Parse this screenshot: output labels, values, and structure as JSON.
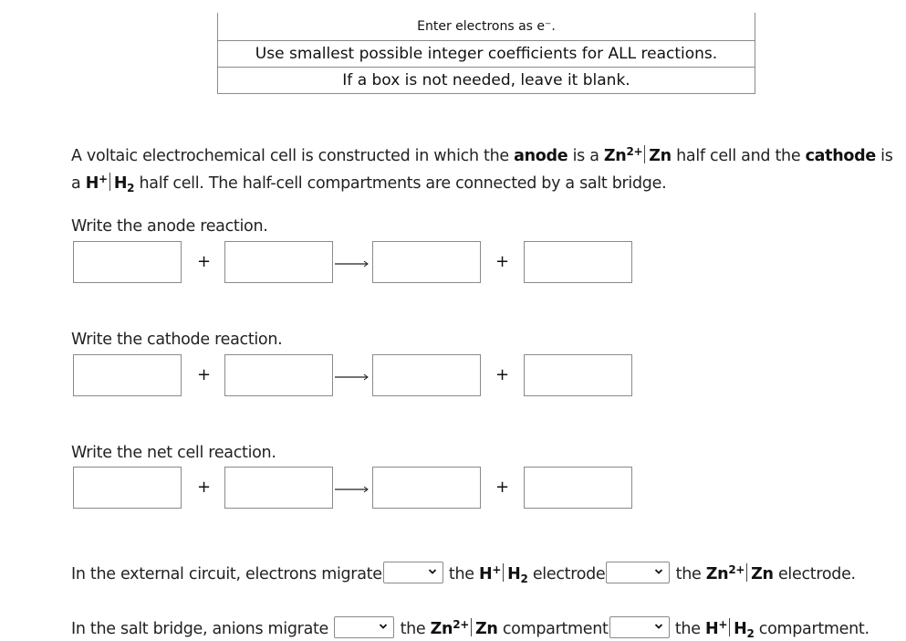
{
  "instructions": [
    "Enter electrons as e⁻.",
    "Use smallest possible integer coefficients for ALL reactions.",
    "If a box is not needed, leave it blank."
  ],
  "intro": {
    "p1": "A voltaic electrochemical cell is constructed in which the ",
    "anode_word": "anode",
    "p2": " is a ",
    "anode_ion": "Zn",
    "anode_ion_charge": "2+",
    "anode_metal": "Zn",
    "p3": " half cell and the ",
    "cathode_word": "cathode",
    "p4": " is a ",
    "cathode_ion": "H",
    "cathode_ion_charge": "+",
    "cathode_gas": "H",
    "cathode_gas_sub": "2",
    "p5": " half cell. The half-cell compartments are connected by a salt bridge."
  },
  "reactions": [
    {
      "prompt": "Write the anode reaction.",
      "inputs": [
        "",
        "",
        "",
        ""
      ]
    },
    {
      "prompt": "Write the cathode reaction.",
      "inputs": [
        "",
        "",
        "",
        ""
      ]
    },
    {
      "prompt": "Write the net cell reaction.",
      "inputs": [
        "",
        "",
        "",
        ""
      ]
    }
  ],
  "symbols": {
    "plus": "+",
    "arrow": "arrow-right-icon"
  },
  "external_circuit": {
    "lead": "In the external circuit, electrons migrate",
    "select1_value": "",
    "mid1": "the ",
    "h_ion": "H",
    "h_charge": "+",
    "h_gas": "H",
    "h_sub": "2",
    "mid2": " electrode",
    "select2_value": "",
    "mid3": "the ",
    "zn_ion": "Zn",
    "zn_charge": "2+",
    "zn_metal": "Zn",
    "end": " electrode."
  },
  "salt_bridge": {
    "lead": "In the salt bridge, anions migrate",
    "select1_value": "",
    "mid1": "the ",
    "zn_ion": "Zn",
    "zn_charge": "2+",
    "zn_metal": "Zn",
    "mid2": " compartment",
    "select2_value": "",
    "mid3": "the ",
    "h_ion": "H",
    "h_charge": "+",
    "h_gas": "H",
    "h_sub": "2",
    "end": " compartment."
  }
}
